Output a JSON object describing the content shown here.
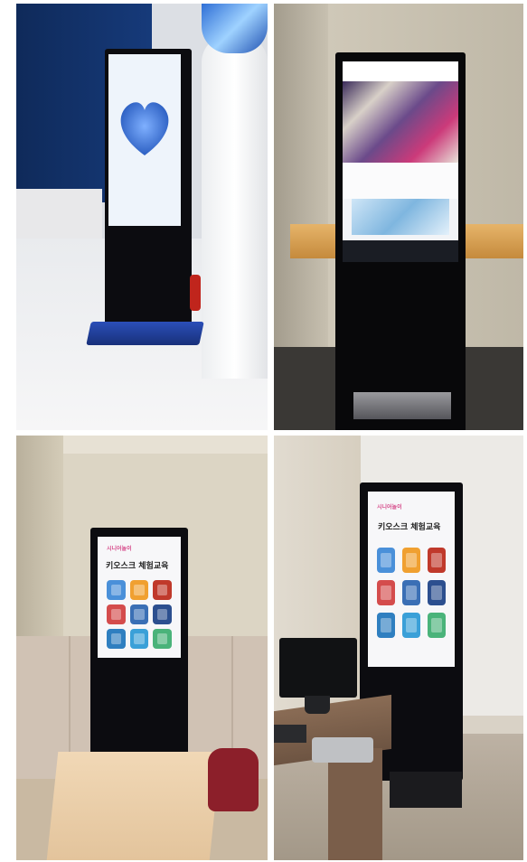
{
  "photos": [
    {
      "id": "top-left",
      "kind": "kiosk-heart-screen"
    },
    {
      "id": "top-right",
      "kind": "kiosk-website-screen"
    },
    {
      "id": "bottom-left",
      "kind": "kiosk-classroom",
      "screen": {
        "logo": "시니어놀이",
        "title": "키오스크 체험교육"
      }
    },
    {
      "id": "bottom-right",
      "kind": "kiosk-computer-lab",
      "screen": {
        "logo": "시니어놀이",
        "title": "키오스크 체험교육"
      }
    }
  ],
  "tile_colors": [
    "#4a90d9",
    "#f0a030",
    "#c0392b",
    "#d44c4c",
    "#3a6fb5",
    "#2c4f8f",
    "#2f7fc0",
    "#3aa0d8",
    "#4ab37a"
  ],
  "colors": {
    "kiosk_body": "#0c0c10",
    "heart": "#4a7fd4",
    "pink_logo": "#d64a8a"
  }
}
